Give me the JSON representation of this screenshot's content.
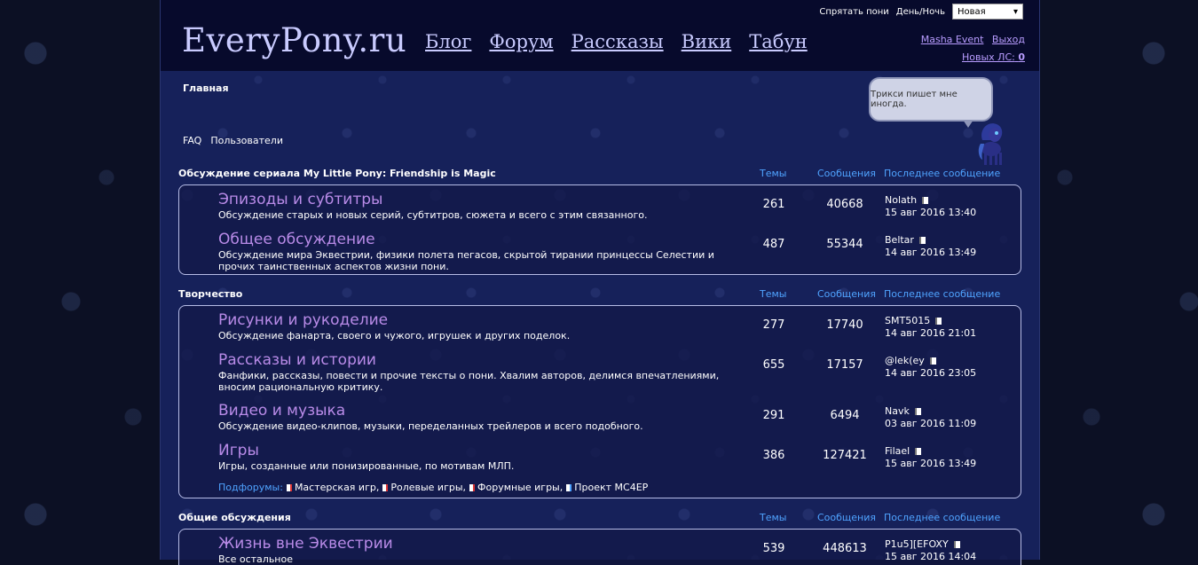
{
  "header": {
    "logo": "EveryPony.ru",
    "nav": [
      "Блог",
      "Форум",
      "Рассказы",
      "Вики",
      "Табун"
    ],
    "hide_ponies": "Спрятать пони",
    "daynight": "День/Ночь",
    "theme_value": "Новая",
    "user": "Masha Event",
    "logout": "Выход",
    "new_pm_label": "Новых ЛС:",
    "new_pm_count": "0"
  },
  "breadcrumb": "Главная",
  "sublinks": [
    "FAQ",
    "Пользователи"
  ],
  "speech": "Трикси пишет мне иногда.",
  "columns": {
    "topics": "Темы",
    "posts": "Сообщения",
    "last": "Последнее сообщение"
  },
  "categories": [
    {
      "title": "Обсуждение сериала My Little Pony: Friendship is Magic",
      "forums": [
        {
          "name": "Эпизоды и субтитры",
          "desc": "Обсуждение старых и новых серий, субтитров, сюжета и всего с этим связанного.",
          "topics": "261",
          "posts": "40668",
          "last_user": "Nolath",
          "last_date": "15 авг 2016 13:40"
        },
        {
          "name": "Общее обсуждение",
          "desc": "Обсуждение мира Эквестрии, физики полета пегасов, скрытой тирании принцессы Селестии и прочих таинственных аспектов жизни пони.",
          "topics": "487",
          "posts": "55344",
          "last_user": "Beltar",
          "last_date": "14 авг 2016 13:49"
        }
      ]
    },
    {
      "title": "Творчество",
      "forums": [
        {
          "name": "Рисунки и рукоделие",
          "desc": "Обсуждение фанарта, своего и чужого, игрушек и других поделок.",
          "topics": "277",
          "posts": "17740",
          "last_user": "SMT5015",
          "last_date": "14 авг 2016 21:01"
        },
        {
          "name": "Рассказы и истории",
          "desc": "Фанфики, рассказы, повести и прочие тексты о пони. Хвалим авторов, делимся впечатлениями, вносим рациональную критику.",
          "topics": "655",
          "posts": "17157",
          "last_user": "@lek(ey",
          "last_date": "14 авг 2016 23:05"
        },
        {
          "name": "Видео и музыка",
          "desc": "Обсуждение видео-клипов, музыки, переделанных трейлеров и всего подобного.",
          "topics": "291",
          "posts": "6494",
          "last_user": "Navk",
          "last_date": "03 авг 2016 11:09"
        },
        {
          "name": "Игры",
          "desc": "Игры, созданные или понизированные, по мотивам МЛП.",
          "topics": "386",
          "posts": "127421",
          "last_user": "Filael",
          "last_date": "15 авг 2016 13:49"
        }
      ],
      "subforums_label": "Подфорумы:",
      "subforums": [
        "Мастерская игр,",
        "Ролевые игры,",
        "Форумные игры,",
        "Проект MC4EP"
      ]
    },
    {
      "title": "Общие обсуждения",
      "forums": [
        {
          "name": "Жизнь вне Эквестрии",
          "desc": "Все остальное",
          "topics": "539",
          "posts": "448613",
          "last_user": "P1u5][EFOXY",
          "last_date": "15 авг 2016 14:04"
        }
      ]
    }
  ]
}
